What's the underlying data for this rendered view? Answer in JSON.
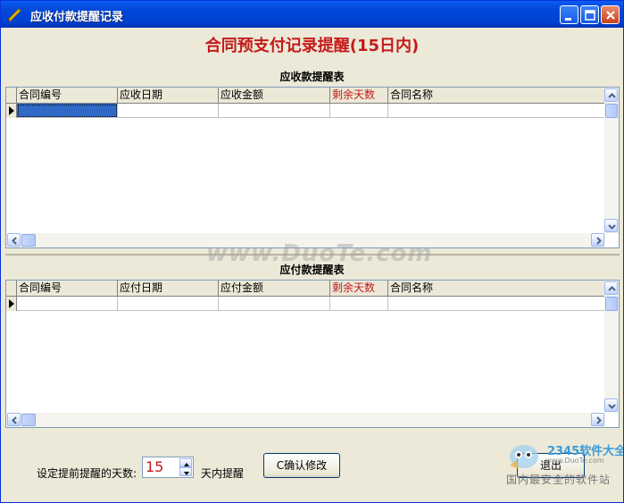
{
  "window": {
    "title": "应收付款提醒记录"
  },
  "heading": "合同预支付记录提醒(15日内)",
  "receivable": {
    "title": "应收款提醒表",
    "columns": [
      "合同编号",
      "应收日期",
      "应收金额",
      "剩余天数",
      "合同名称"
    ]
  },
  "payable": {
    "title": "应付款提醒表",
    "columns": [
      "合同编号",
      "应付日期",
      "应付金额",
      "剩余天数",
      "合同名称"
    ]
  },
  "footer": {
    "days_label": "设定提前提醒的天数:",
    "days_value": "15",
    "unit_label": "天内提醒",
    "confirm_button": "C确认修改",
    "exit_button": "退出"
  },
  "watermark": "www.DuoTe.com",
  "logo": {
    "brand": "2345软件大全",
    "sub": "www.DuoTe.com",
    "slogan": "国内最安全的软件站"
  },
  "colors": {
    "accent_red": "#c41a1a",
    "titlebar": "#0146d6",
    "selection": "#316ac5"
  }
}
